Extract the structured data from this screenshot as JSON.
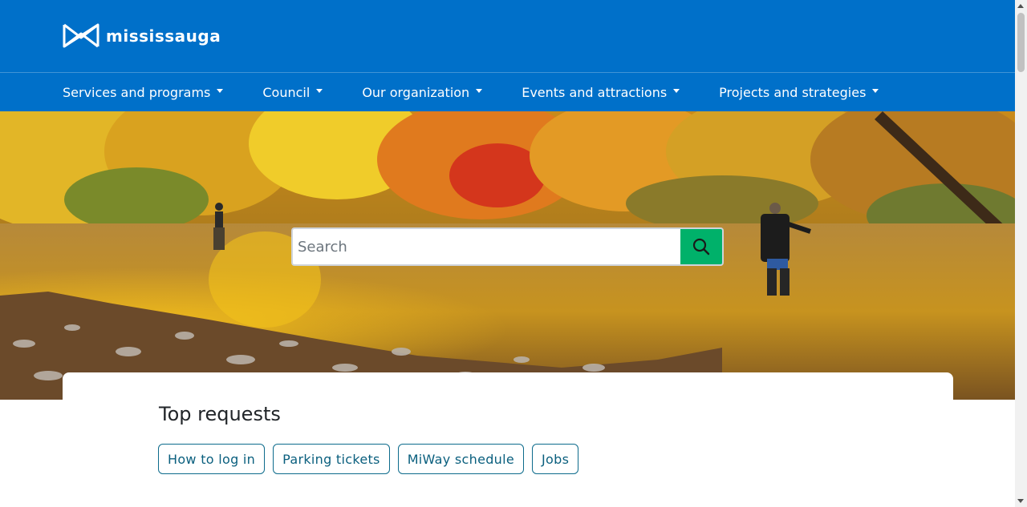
{
  "header": {
    "logo_text": "MISSISSAUGA",
    "logo_icon": "mississauga-m-icon"
  },
  "nav": {
    "items": [
      {
        "label": "Services and programs"
      },
      {
        "label": "Council"
      },
      {
        "label": "Our organization"
      },
      {
        "label": "Events and attractions"
      },
      {
        "label": "Projects and strategies"
      }
    ]
  },
  "hero": {
    "image": "autumn river with anglers",
    "search": {
      "placeholder": "Search",
      "value": "",
      "button_icon": "search-icon"
    }
  },
  "top_requests": {
    "title": "Top requests",
    "items": [
      {
        "label": "How to log in"
      },
      {
        "label": "Parking tickets"
      },
      {
        "label": "MiWay schedule"
      },
      {
        "label": "Jobs"
      }
    ]
  },
  "colors": {
    "header_blue": "#0070c9",
    "search_green": "#00b16a",
    "chip_text": "#0a5f7e"
  }
}
